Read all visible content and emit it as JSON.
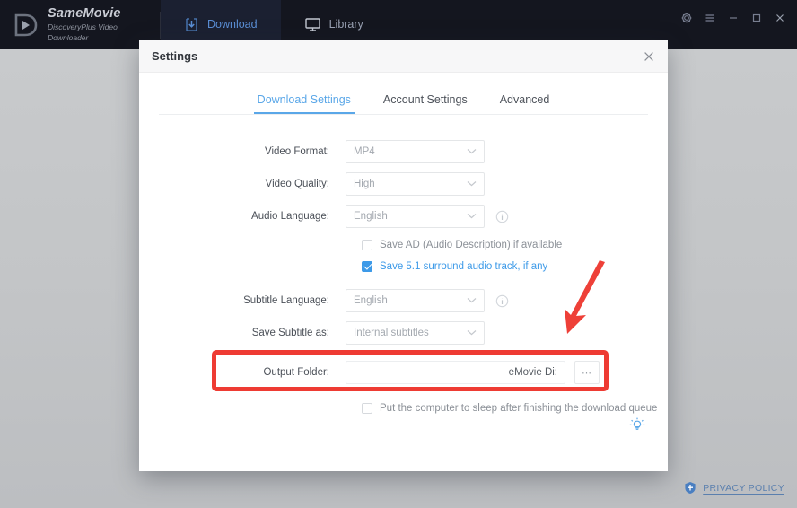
{
  "app": {
    "brand_title": "SameMovie",
    "brand_subtitle": "DiscoveryPlus Video Downloader",
    "nav": [
      {
        "label": "Download",
        "icon": "download-icon",
        "active": true
      },
      {
        "label": "Library",
        "icon": "monitor-icon",
        "active": false
      }
    ],
    "window_controls": [
      {
        "name": "settings-gear",
        "glyph": "gear-icon"
      },
      {
        "name": "menu",
        "glyph": "hamburger-icon"
      },
      {
        "name": "minimize",
        "glyph": "minimize-icon"
      },
      {
        "name": "maximize",
        "glyph": "maximize-icon"
      },
      {
        "name": "close",
        "glyph": "close-icon"
      }
    ]
  },
  "dialog": {
    "title": "Settings",
    "close_label": "✕",
    "tabs": [
      {
        "label": "Download Settings",
        "active": true
      },
      {
        "label": "Account Settings",
        "active": false
      },
      {
        "label": "Advanced",
        "active": false
      }
    ],
    "fields": {
      "video_format": {
        "label": "Video Format:",
        "value": "MP4"
      },
      "video_quality": {
        "label": "Video Quality:",
        "value": "High"
      },
      "audio_language": {
        "label": "Audio Language:",
        "value": "English"
      },
      "subtitle_language": {
        "label": "Subtitle Language:",
        "value": "English"
      },
      "save_subtitle_as": {
        "label": "Save Subtitle as:",
        "value": "Internal subtitles"
      },
      "output_folder": {
        "label": "Output Folder:",
        "value": "eMovie Di:",
        "browse_label": "⋯"
      }
    },
    "checkboxes": {
      "save_ad": {
        "label": "Save AD (Audio Description) if available",
        "checked": false
      },
      "save_surround": {
        "label": "Save 5.1 surround audio track, if any",
        "checked": true
      },
      "sleep_after": {
        "label": "Put the computer to sleep after finishing the download queue",
        "checked": false
      }
    },
    "tip_icon": "lightbulb-icon"
  },
  "footer": {
    "privacy_label": "PRIVACY POLICY",
    "privacy_icon": "shield-icon"
  },
  "annotations": {
    "highlight_color": "#ee3b33",
    "arrow_color": "#ee4038"
  }
}
